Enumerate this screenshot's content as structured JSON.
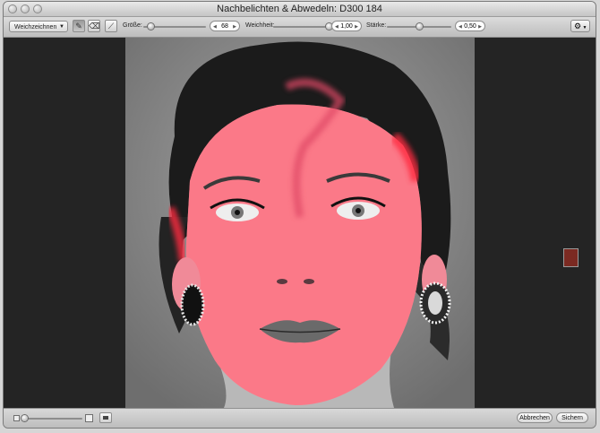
{
  "window": {
    "title": "Nachbelichten & Abwedeln: D300 184"
  },
  "toolbar": {
    "brush_mode": "Weichzeichnen",
    "size": {
      "label": "Größe:",
      "value": "68",
      "level": 0.12
    },
    "softness": {
      "label": "Weichheit:",
      "value": "1,00",
      "level": 1.0
    },
    "strength": {
      "label": "Stärke:",
      "value": "0,50",
      "level": 0.5
    }
  },
  "footer": {
    "cancel_label": "Abbrechen",
    "save_label": "Sichern",
    "zoom_level": 0.02
  },
  "colors": {
    "overlay": "#ff5a6e",
    "canvas_bg": "#242424",
    "nav_marker": "#7b2a22"
  },
  "icons": [
    "brush-tool-icon",
    "eraser-tool-icon",
    "feather-tool-icon",
    "gear-icon",
    "zoom-out-icon",
    "zoom-in-icon",
    "filmstrip-icon"
  ]
}
